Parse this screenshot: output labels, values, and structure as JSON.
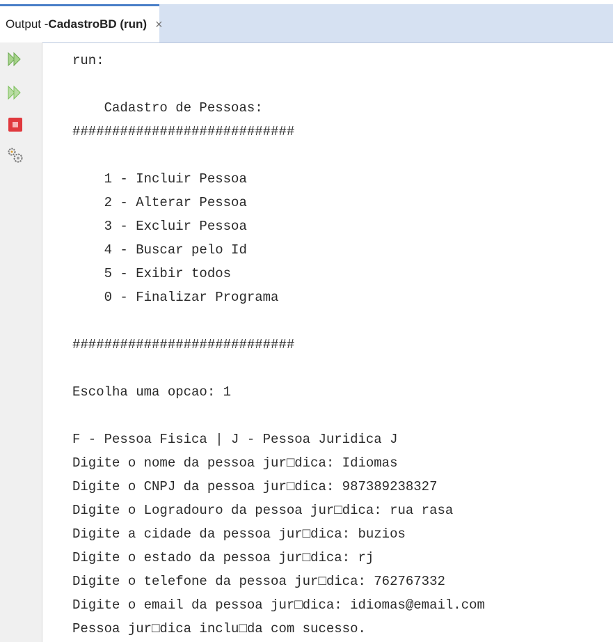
{
  "tab": {
    "prefix": "Output - ",
    "name": "CadastroBD (run)",
    "close_glyph": "×"
  },
  "gutter": {
    "icons": [
      "rerun-icon",
      "rerun-with-options-icon",
      "stop-icon",
      "settings-icon"
    ]
  },
  "console": {
    "lines": [
      "run:",
      "",
      "    Cadastro de Pessoas:",
      "############################",
      "",
      "    1 - Incluir Pessoa",
      "    2 - Alterar Pessoa",
      "    3 - Excluir Pessoa",
      "    4 - Buscar pelo Id",
      "    5 - Exibir todos",
      "    0 - Finalizar Programa",
      "",
      "############################",
      "",
      "Escolha uma opcao: 1",
      "",
      "F - Pessoa Fisica | J - Pessoa Juridica J",
      "Digite o nome da pessoa jur□dica: Idiomas",
      "Digite o CNPJ da pessoa jur□dica: 987389238327",
      "Digite o Logradouro da pessoa jur□dica: rua rasa",
      "Digite a cidade da pessoa jur□dica: buzios",
      "Digite o estado da pessoa jur□dica: rj",
      "Digite o telefone da pessoa jur□dica: 762767332",
      "Digite o email da pessoa jur□dica: idiomas@email.com",
      "Pessoa jur□dica inclu□da com sucesso."
    ]
  },
  "colors": {
    "tab_accent": "#4a7fc8",
    "rerun_green": "#7bbf5a",
    "stop_red": "#e0393e"
  }
}
